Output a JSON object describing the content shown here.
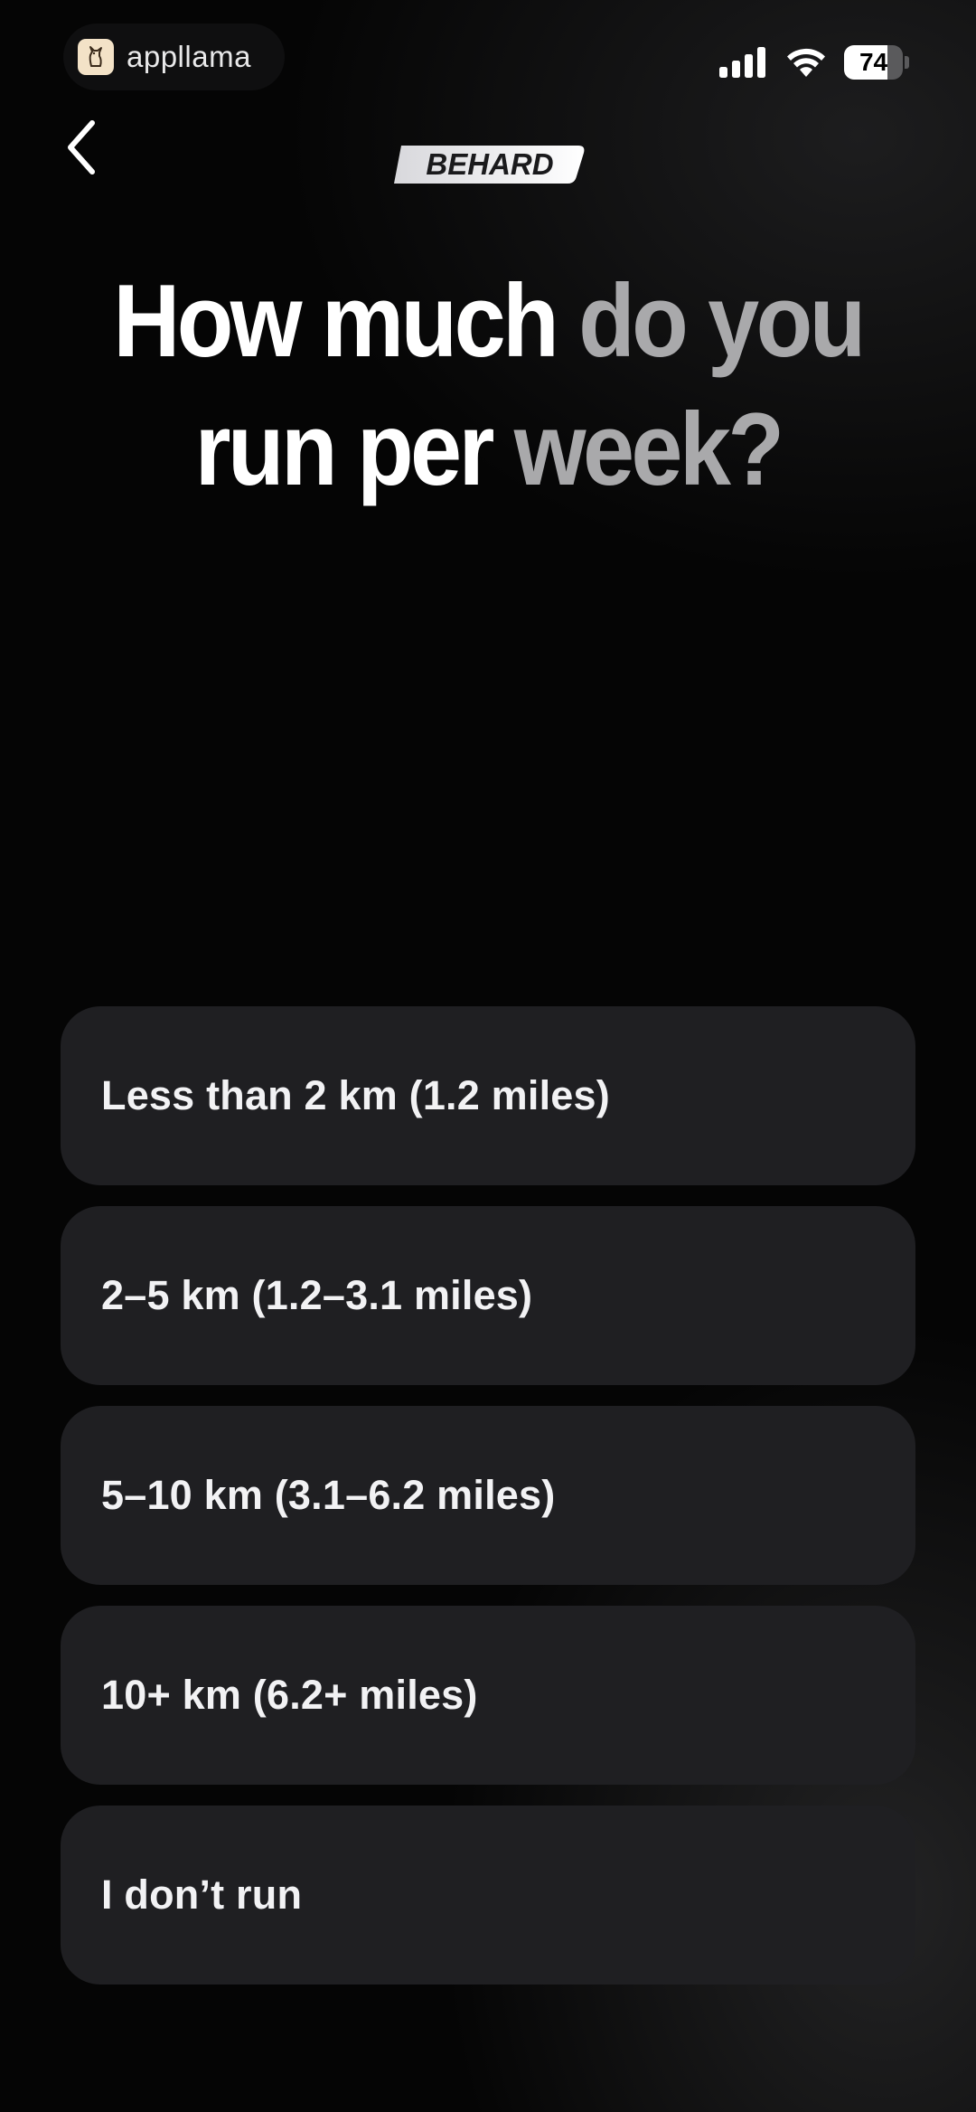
{
  "status_bar": {
    "app_name": "appllama",
    "battery_level": "74",
    "battery_fraction": 0.74
  },
  "header": {
    "logo_text": "BEHARD"
  },
  "question": {
    "line1_white": "How much",
    "line1_gray": "do you",
    "line2_white": "run per",
    "line2_gray": "week?"
  },
  "options": [
    {
      "label": "Less than 2 km (1.2 miles)"
    },
    {
      "label": "2–5 km (1.2–3.1 miles)"
    },
    {
      "label": "5–10 km (3.1–6.2 miles)"
    },
    {
      "label": "10+ km (6.2+ miles)"
    },
    {
      "label": "I don’t run"
    }
  ],
  "colors": {
    "background": "#050505",
    "option_background": "#1f1f22",
    "title_accent_gray": "#a9a9ab"
  }
}
